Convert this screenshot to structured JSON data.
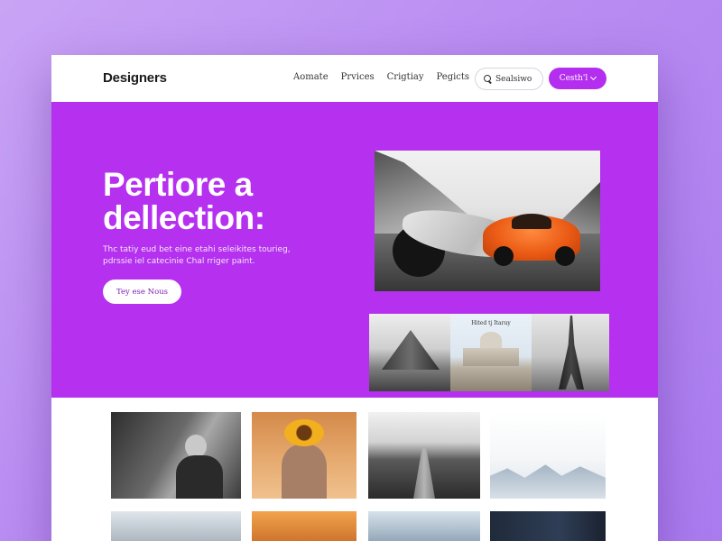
{
  "brand": {
    "name": "Designers"
  },
  "nav": {
    "links": [
      "Aomate",
      "Prvices",
      "Crigtiay",
      "Pegicts"
    ]
  },
  "search": {
    "value": "Sealsiwo",
    "icon": "search-icon"
  },
  "contact": {
    "label": "Cesth'l",
    "icon": "chevron-down-icon"
  },
  "hero": {
    "title": "Pertiore a dellection:",
    "subtitle": "Thc tatiy eud bet eine etahi seleikites tourieg, pdrssie iel catecinie Chal rriger paint.",
    "cta_label": "Tey ese Nous",
    "thumbnail_caption": "Hited tj Itaruy"
  },
  "colors": {
    "hero_bg": "#b530ef",
    "accent": "#b42ef0",
    "page_bg": "#bf95f3"
  }
}
